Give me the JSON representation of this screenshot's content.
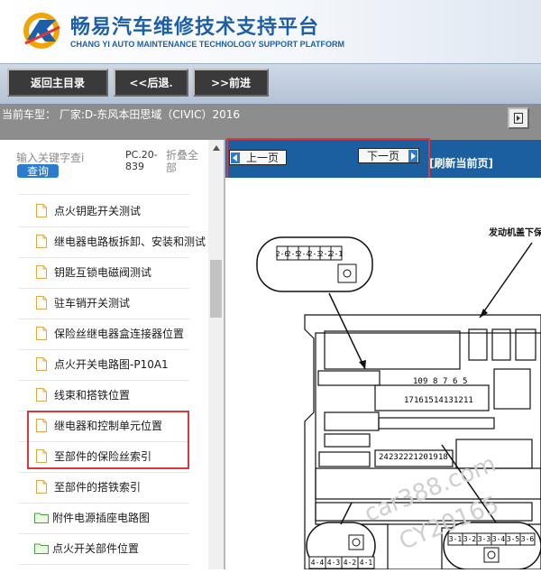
{
  "header": {
    "title": "畅易汽车维修技术支持平台",
    "subtitle": "CHANG YI AUTO MAINTENANCE TECHNOLOGY SUPPORT PLATFORM",
    "brand_color": "#1c5fa8"
  },
  "toolbar": {
    "home_label": "返回主目录",
    "back_label": "<<后退.",
    "forward_label": ">>前进"
  },
  "vehicle": {
    "current_model": "当前车型：  厂家:D-东风本田思域（CIVIC）2016"
  },
  "sidebar": {
    "search_placeholder": "输入关键字查i",
    "search_button": "查询",
    "pc_label": "PC.20-839",
    "fold_label": "折叠全部",
    "items": [
      {
        "label": "点火钥匙开关测试",
        "icon": "document-icon"
      },
      {
        "label": "继电器电路板拆卸、安装和测试",
        "icon": "document-icon"
      },
      {
        "label": "钥匙互锁电磁阀测试",
        "icon": "document-icon"
      },
      {
        "label": "驻车销开关测试",
        "icon": "document-icon"
      },
      {
        "label": "保险丝继电器盒连接器位置",
        "icon": "document-icon"
      },
      {
        "label": "点火开关电路图-P10A1",
        "icon": "document-icon"
      },
      {
        "label": "线束和搭铁位置",
        "icon": "document-icon"
      },
      {
        "label": "继电器和控制单元位置",
        "icon": "document-icon"
      },
      {
        "label": "至部件的保险丝索引",
        "icon": "document-icon"
      },
      {
        "label": "至部件的搭铁索引",
        "icon": "document-icon"
      },
      {
        "label": "附件电源插座电路图",
        "icon": "folder-icon"
      },
      {
        "label": "点火开关部件位置",
        "icon": "folder-icon"
      }
    ]
  },
  "pager": {
    "prev_label": "上一页",
    "next_label": "下一页",
    "refresh_label": "[刷新当前页]"
  },
  "diagram": {
    "top_connector_pins": [
      "2-6",
      "2-5",
      "2-4",
      "2-3",
      "2-2",
      "2-1"
    ],
    "callout_label": "发动机盖下保",
    "fuse_row_top": [
      "10",
      "9",
      "8",
      "7",
      "6",
      "5"
    ],
    "fuse_row_bottom": [
      "17",
      "16",
      "15",
      "14",
      "13",
      "12",
      "11"
    ],
    "relay_numbers": [
      "24",
      "23",
      "22",
      "21",
      "20",
      "19",
      "18"
    ],
    "right_connector_pins": [
      "3-1",
      "3-2",
      "3-3",
      "3-4",
      "3-5",
      "3-6"
    ],
    "bottom_connector_pins": [
      "4-4",
      "4-3",
      "4-2",
      "4-1"
    ]
  },
  "watermark": {
    "line1": "car388.com",
    "line2": "CY20165"
  }
}
